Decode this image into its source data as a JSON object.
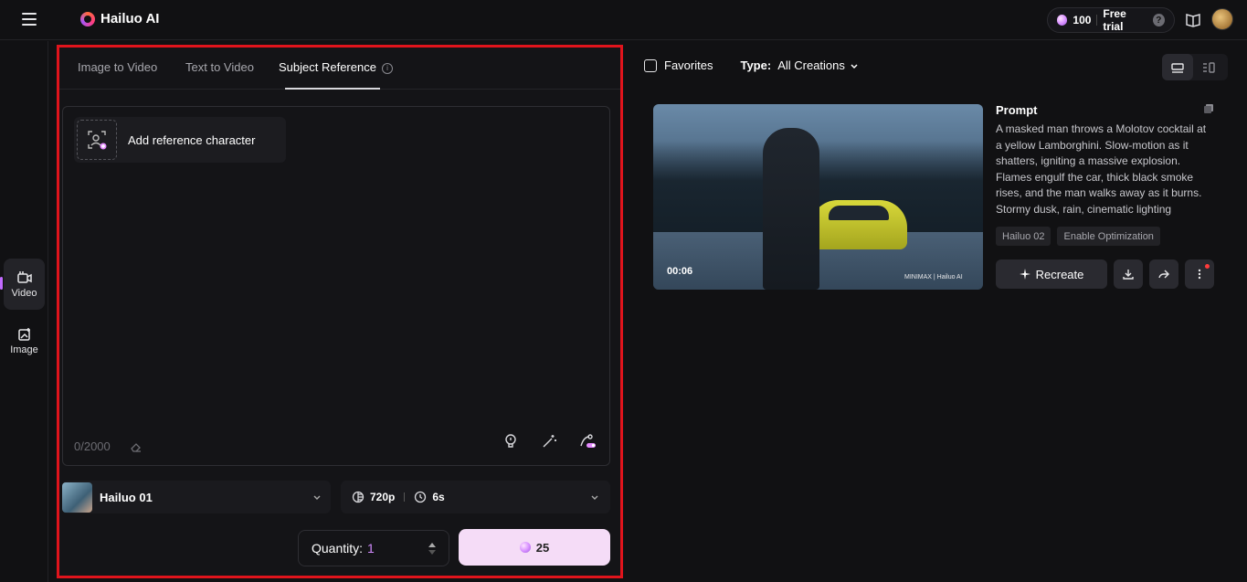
{
  "app": {
    "title": "Hailuo AI"
  },
  "topbar": {
    "credits": "100",
    "free_trial_label": "Free trial",
    "help_label": "?"
  },
  "leftrail": {
    "items": [
      {
        "label": "Video",
        "icon": "video-icon"
      },
      {
        "label": "Image",
        "icon": "image-icon"
      }
    ]
  },
  "tabs": [
    {
      "label": "Image to Video"
    },
    {
      "label": "Text to Video"
    },
    {
      "label": "Subject Reference",
      "active": true
    }
  ],
  "prompt_box": {
    "add_reference_label": "Add reference character",
    "char_count": "0/2000"
  },
  "model": {
    "name": "Hailuo 01"
  },
  "settings": {
    "resolution": "720p",
    "duration": "6s"
  },
  "quantity": {
    "label": "Quantity:",
    "value": "1"
  },
  "generate": {
    "cost": "25"
  },
  "filters": {
    "favorites_label": "Favorites",
    "type_label": "Type:",
    "type_value": "All Creations"
  },
  "creation": {
    "duration": "00:06",
    "watermark": "MINIMAX | Hailuo AI",
    "prompt_title": "Prompt",
    "prompt_text": "A masked man throws a Molotov cocktail at a yellow Lamborghini. Slow-motion as it shatters, igniting a massive explosion. Flames engulf the car, thick black smoke rises, and the man walks away as it burns. Stormy dusk, rain, cinematic lighting",
    "tags": [
      "Hailuo 02",
      "Enable Optimization"
    ],
    "recreate_label": "Recreate"
  },
  "colors": {
    "accent": "#c26bff",
    "highlight_border": "#e0141c",
    "generate_bg": "#f5dcf7"
  }
}
